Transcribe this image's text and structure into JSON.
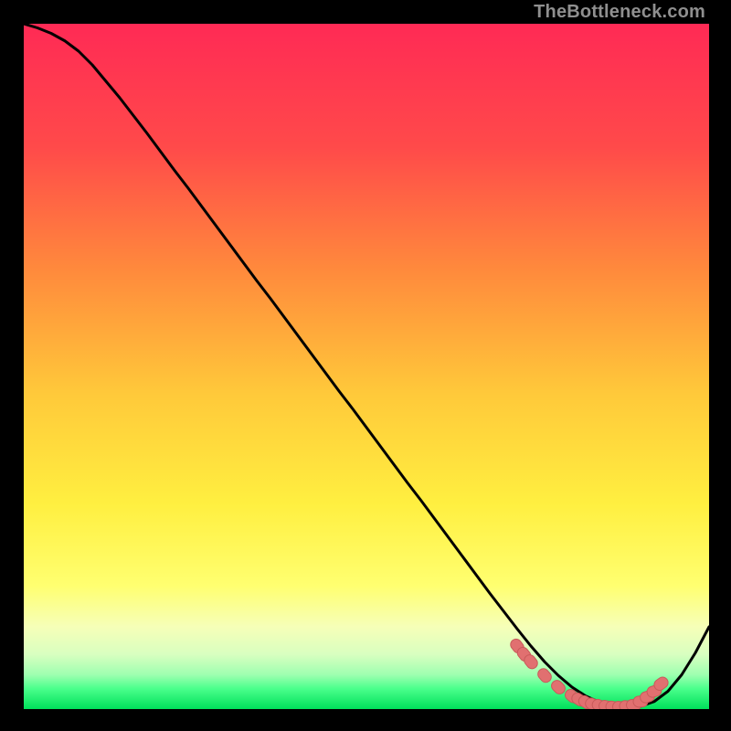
{
  "watermark": "TheBottleneck.com",
  "colors": {
    "page_bg": "#000000",
    "grad_top": "#ff2a55",
    "grad_mid_upper": "#ff7a3c",
    "grad_mid": "#ffd23a",
    "grad_mid_lower": "#ffff55",
    "grad_lower": "#f4ffb0",
    "grad_green_light": "#c8ffb4",
    "grad_green": "#2bff7a",
    "grad_green_deep": "#00e05a",
    "curve": "#000000",
    "marker_fill": "#e17070",
    "marker_stroke": "#c85a5a"
  },
  "chart_data": {
    "type": "line",
    "title": "",
    "xlabel": "",
    "ylabel": "",
    "xlim": [
      0,
      100
    ],
    "ylim": [
      0,
      100
    ],
    "series": [
      {
        "name": "bottleneck-curve",
        "x": [
          0,
          2,
          4,
          6,
          8,
          10,
          12,
          14,
          16,
          18,
          20,
          22,
          24,
          26,
          28,
          30,
          32,
          34,
          36,
          38,
          40,
          42,
          44,
          46,
          48,
          50,
          52,
          54,
          56,
          58,
          60,
          62,
          64,
          66,
          68,
          70,
          72,
          74,
          76,
          78,
          80,
          82,
          84,
          86,
          88,
          90,
          92,
          94,
          96,
          98,
          100
        ],
        "values": [
          100,
          99.4,
          98.6,
          97.5,
          96.0,
          94.0,
          91.6,
          89.2,
          86.6,
          84.0,
          81.3,
          78.6,
          76.0,
          73.3,
          70.6,
          67.9,
          65.2,
          62.5,
          59.9,
          57.2,
          54.5,
          51.8,
          49.1,
          46.4,
          43.8,
          41.1,
          38.4,
          35.7,
          33.0,
          30.4,
          27.7,
          25.0,
          22.3,
          19.6,
          16.9,
          14.3,
          11.7,
          9.2,
          6.9,
          4.9,
          3.2,
          1.9,
          1.0,
          0.5,
          0.3,
          0.4,
          1.1,
          2.6,
          5.0,
          8.2,
          12.0
        ]
      }
    ],
    "markers": [
      {
        "x": 72,
        "y": 9.2
      },
      {
        "x": 73,
        "y": 8.0
      },
      {
        "x": 74,
        "y": 6.9
      },
      {
        "x": 76,
        "y": 4.9
      },
      {
        "x": 78,
        "y": 3.2
      },
      {
        "x": 80,
        "y": 1.9
      },
      {
        "x": 81,
        "y": 1.4
      },
      {
        "x": 82,
        "y": 1.0
      },
      {
        "x": 83,
        "y": 0.7
      },
      {
        "x": 84,
        "y": 0.5
      },
      {
        "x": 85,
        "y": 0.4
      },
      {
        "x": 86,
        "y": 0.3
      },
      {
        "x": 87,
        "y": 0.3
      },
      {
        "x": 88,
        "y": 0.4
      },
      {
        "x": 89,
        "y": 0.6
      },
      {
        "x": 90,
        "y": 1.1
      },
      {
        "x": 91,
        "y": 1.8
      },
      {
        "x": 92,
        "y": 2.6
      },
      {
        "x": 93,
        "y": 3.7
      }
    ]
  }
}
